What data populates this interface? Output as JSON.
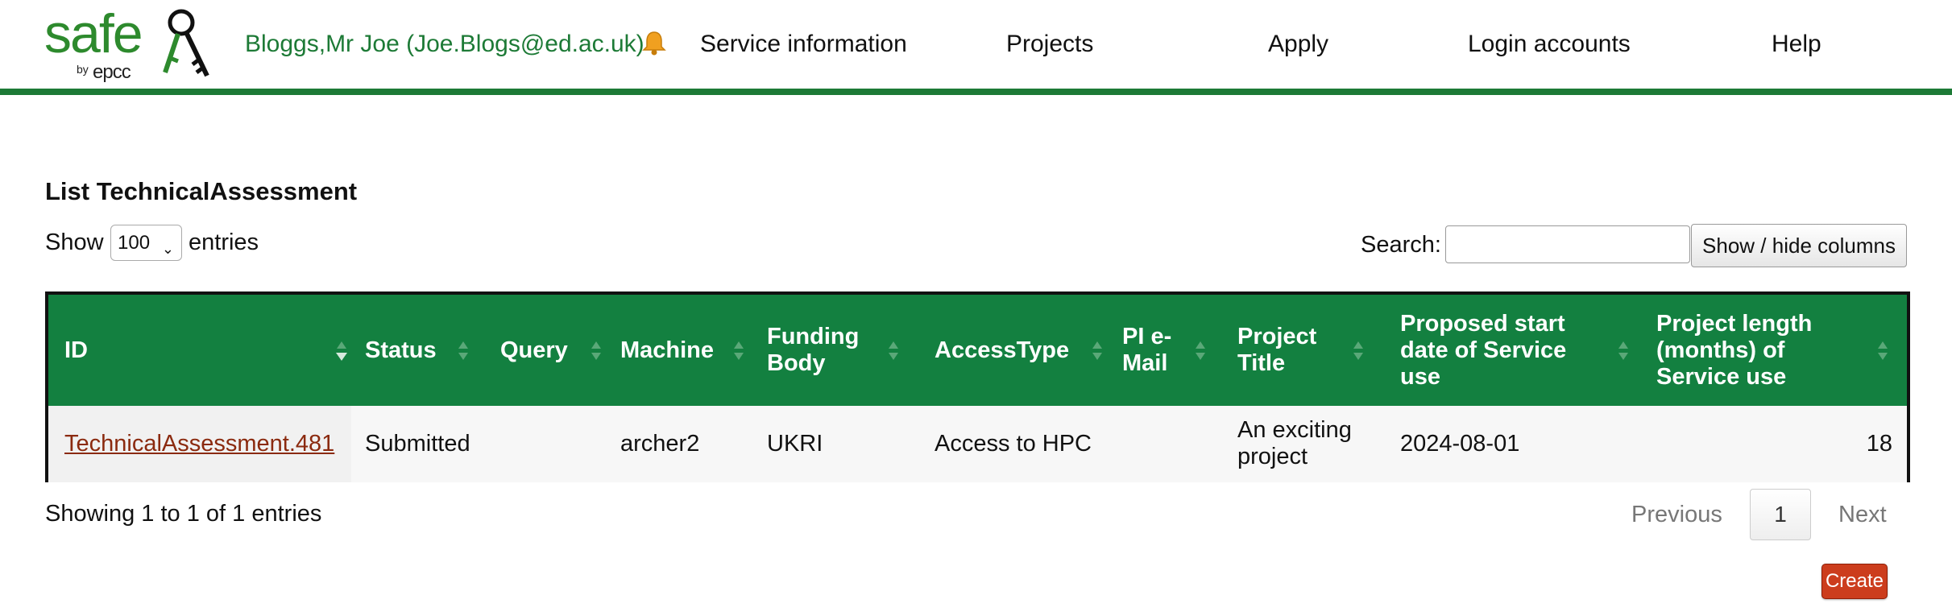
{
  "header": {
    "logo": {
      "main": "safe",
      "by": "by",
      "org": "epcc"
    },
    "user_link": "Bloggs,Mr Joe (Joe.Blogs@ed.ac.uk)",
    "nav": [
      "Service information",
      "Projects",
      "Apply",
      "Login accounts",
      "Help"
    ],
    "brand_color": "#1d7a36"
  },
  "page": {
    "title": "List TechnicalAssessment",
    "show_label": "Show",
    "entries_value": "100",
    "entries_label": "entries",
    "search_label": "Search:",
    "search_value": "",
    "colvis_label": "Show / hide columns"
  },
  "table": {
    "header_color": "#138040",
    "columns": [
      "ID",
      "Status",
      "Query",
      "Machine",
      "Funding Body",
      "AccessType",
      "PI e-Mail",
      "Project Title",
      "Proposed start date of Service use",
      "Project length (months) of Service use"
    ],
    "rows": [
      {
        "id": "TechnicalAssessment.481",
        "status": "Submitted",
        "query": "",
        "machine": "archer2",
        "funding_body": "UKRI",
        "access_type": "Access to HPC",
        "pi_email": "",
        "project_title": "An exciting project",
        "start_date": "2024-08-01",
        "length_months": "18"
      }
    ]
  },
  "footer": {
    "info": "Showing 1 to 1 of 1 entries",
    "previous": "Previous",
    "current_page": "1",
    "next": "Next",
    "create_label": "Create",
    "create_color": "#cc3d1d"
  }
}
